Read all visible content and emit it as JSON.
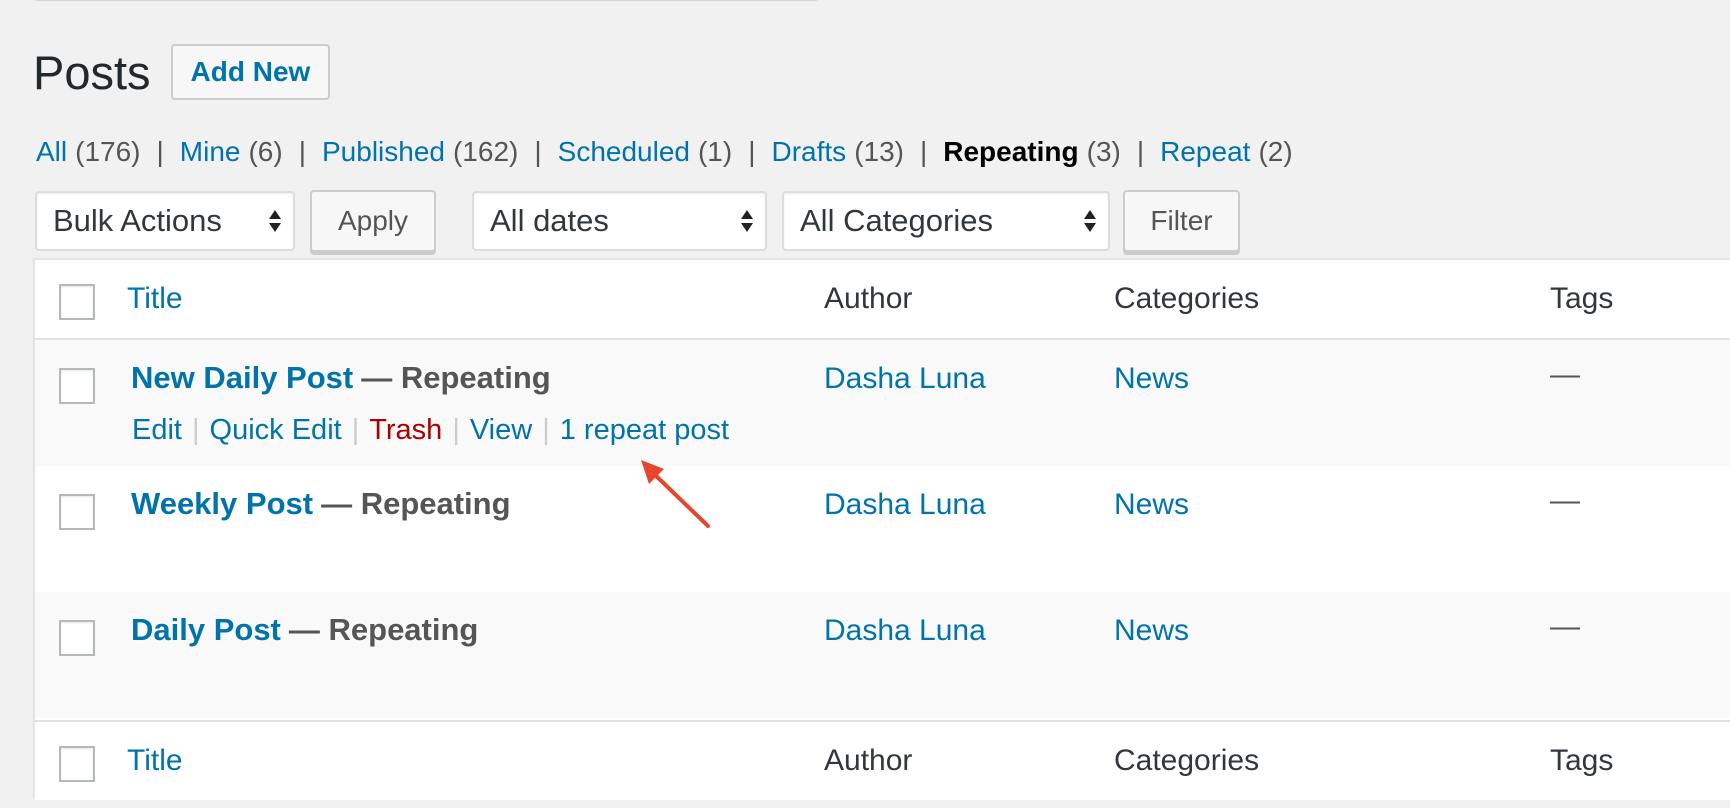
{
  "page": {
    "title": "Posts",
    "add_new_label": "Add New"
  },
  "views": [
    {
      "label": "All",
      "count": "(176)",
      "current": false
    },
    {
      "label": "Mine",
      "count": "(6)",
      "current": false
    },
    {
      "label": "Published",
      "count": "(162)",
      "current": false
    },
    {
      "label": "Scheduled",
      "count": "(1)",
      "current": false
    },
    {
      "label": "Drafts",
      "count": "(13)",
      "current": false
    },
    {
      "label": "Repeating",
      "count": "(3)",
      "current": true
    },
    {
      "label": "Repeat",
      "count": "(2)",
      "current": false
    }
  ],
  "view_separator": "|",
  "toolbar": {
    "bulk_actions": "Bulk Actions",
    "apply_label": "Apply",
    "dates_filter": "All dates",
    "categories_filter": "All Categories",
    "filter_label": "Filter"
  },
  "table": {
    "columns": {
      "title": "Title",
      "author": "Author",
      "categories": "Categories",
      "tags": "Tags"
    },
    "rows": [
      {
        "title": "New Daily Post",
        "state": "— Repeating",
        "author": "Dasha Luna",
        "categories": "News",
        "tags": "—",
        "actions": {
          "edit": "Edit",
          "quick_edit": "Quick Edit",
          "trash": "Trash",
          "view": "View",
          "repeat": "1 repeat post"
        }
      },
      {
        "title": "Weekly Post",
        "state": "— Repeating",
        "author": "Dasha Luna",
        "categories": "News",
        "tags": "—"
      },
      {
        "title": "Daily Post",
        "state": "— Repeating",
        "author": "Dasha Luna",
        "categories": "News",
        "tags": "—"
      }
    ],
    "action_separator": "|"
  },
  "colors": {
    "link": "#0073aa",
    "trash": "#aa0000",
    "annotation_arrow": "#e8452c",
    "background": "#f1f1f1"
  }
}
